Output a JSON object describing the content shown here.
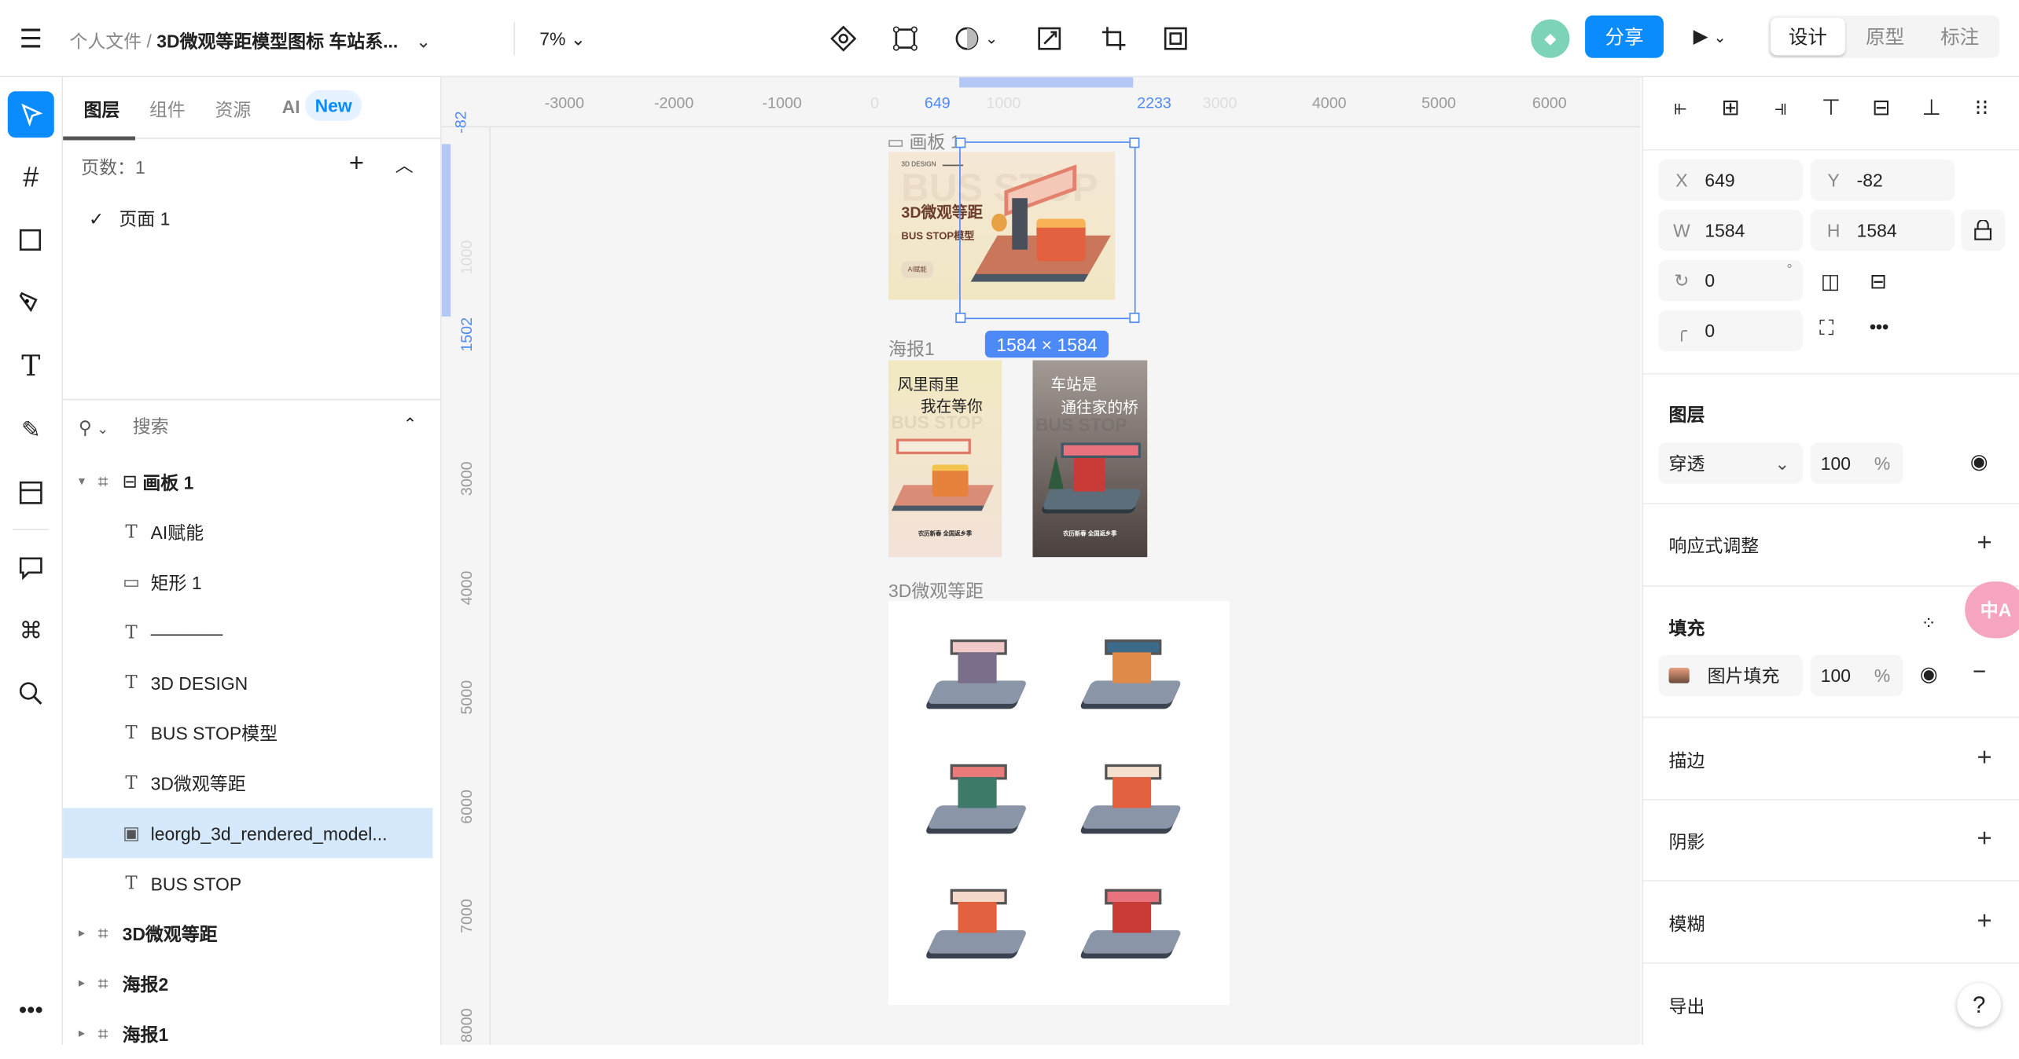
{
  "topbar": {
    "breadcrumb_parent": "个人文件",
    "separator": "/",
    "file_title": "3D微观等距模型图标 车站系...",
    "zoom": "7%",
    "share_label": "分享",
    "modes": [
      "设计",
      "原型",
      "标注"
    ],
    "active_mode": "设计",
    "accent": "#0a8cff"
  },
  "tools": [
    "select",
    "frame",
    "rectangle",
    "pen",
    "text",
    "pencil",
    "slice",
    "comment",
    "plugins",
    "search",
    "more"
  ],
  "layers_panel": {
    "tabs": [
      "图层",
      "组件",
      "资源",
      "AI"
    ],
    "new_badge": "New",
    "active_tab": "图层",
    "pages_label": "页数：1",
    "pages": [
      "页面 1"
    ],
    "search_placeholder": "搜索",
    "items": [
      {
        "label": "画板 1",
        "type": "frame",
        "bold": true
      },
      {
        "label": "AI赋能",
        "type": "text"
      },
      {
        "label": "矩形 1",
        "type": "rect"
      },
      {
        "label": "————",
        "type": "text"
      },
      {
        "label": "3D DESIGN",
        "type": "text"
      },
      {
        "label": "BUS STOP模型",
        "type": "text"
      },
      {
        "label": "3D微观等距",
        "type": "text"
      },
      {
        "label": "leorgb_3d_rendered_model...",
        "type": "image",
        "selected": true
      },
      {
        "label": "BUS STOP",
        "type": "text"
      },
      {
        "label": "3D微观等距",
        "type": "frame",
        "bold": true,
        "collapsed": true
      },
      {
        "label": "海报2",
        "type": "frame",
        "bold": true,
        "collapsed": true
      },
      {
        "label": "海报1",
        "type": "frame",
        "bold": true,
        "collapsed": true
      }
    ]
  },
  "canvas": {
    "ruler_top": [
      "-3000",
      "-2000",
      "-1000",
      "0",
      "649",
      "1000",
      "2233",
      "3000",
      "4000",
      "5000",
      "6000"
    ],
    "ruler_left": [
      "-82",
      "1000",
      "1502",
      "3000",
      "4000",
      "5000",
      "6000",
      "7000",
      "8000"
    ],
    "artboard1": {
      "label": "画板 1",
      "small": "3D DESIGN",
      "big_bg": "BUS STOP",
      "title": "3D微观等距",
      "subtitle": "BUS STOP模型",
      "chip": "AI赋能"
    },
    "size_badge": "1584 × 1584",
    "poster_frame_label": "海报1",
    "poster1": {
      "line1": "风里雨里",
      "line2": "我在等你",
      "bg": "BUS STOP",
      "footer": "农历新春 全国返乡季"
    },
    "poster2": {
      "line1": "车站是",
      "line2": "通往家的桥",
      "bg": "BUS STOP",
      "footer": "农历新春 全国返乡季"
    },
    "icons_frame_label": "3D微观等距"
  },
  "props": {
    "x": "649",
    "y": "-82",
    "w": "1584",
    "h": "1584",
    "rotation": "0",
    "degree": "°",
    "radius": "0",
    "layer_title": "图层",
    "blend": "穿透",
    "opacity": "100",
    "percent": "%",
    "responsive": "响应式调整",
    "fill": "填充",
    "fill_type": "图片填充",
    "fill_opacity": "100",
    "stroke": "描边",
    "shadow": "阴影",
    "blur": "模糊",
    "export": "导出",
    "help": "?",
    "translate": "中A"
  }
}
